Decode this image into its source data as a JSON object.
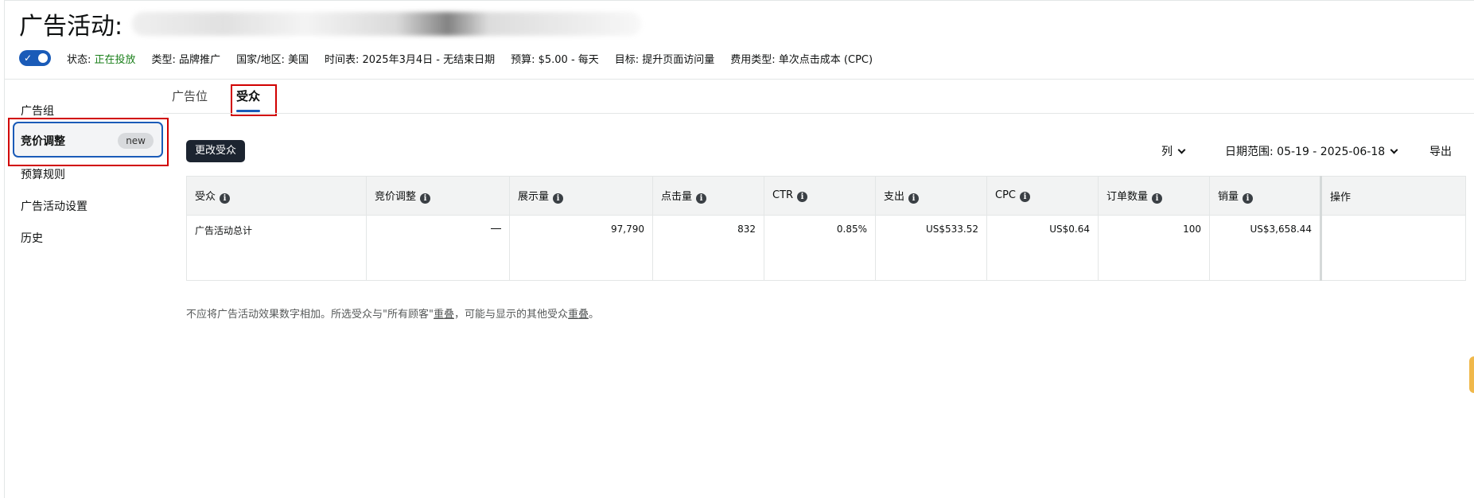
{
  "header": {
    "title": "广告活动:",
    "meta": {
      "status_label": "状态:",
      "status_value": "正在投放",
      "type": "类型: 品牌推广",
      "country": "国家/地区: 美国",
      "schedule": "时间表: 2025年3月4日 - 无结束日期",
      "budget": "预算: $5.00 - 每天",
      "goal": "目标: 提升页面访问量",
      "cost_type": "费用类型: 单次点击成本 (CPC)"
    }
  },
  "sidebar": {
    "items": [
      {
        "label": "广告组"
      },
      {
        "label": "竞价调整",
        "badge": "new"
      },
      {
        "label": "预算规则"
      },
      {
        "label": "广告活动设置"
      },
      {
        "label": "历史"
      }
    ]
  },
  "tabs": [
    {
      "label": "广告位"
    },
    {
      "label": "受众"
    }
  ],
  "toolbar": {
    "change_audience": "更改受众",
    "columns": "列",
    "date_range": "日期范围: 05-19 - 2025-06-18",
    "export": "导出"
  },
  "table": {
    "columns": [
      "受众",
      "竞价调整",
      "展示量",
      "点击量",
      "CTR",
      "支出",
      "CPC",
      "订单数量",
      "销量",
      "操作"
    ],
    "rows": [
      {
        "audience": "广告活动总计",
        "impressions": "97,790",
        "clicks": "832",
        "ctr": "0.85%",
        "spend": "US$533.52",
        "cpc": "US$0.64",
        "orders": "100",
        "sales": "US$3,658.44"
      }
    ]
  },
  "note": {
    "prefix": "不应将广告活动效果数字相加。所选受众与\"所有顾客\"",
    "link1": "重叠",
    "middle": "，可能与显示的其他受众",
    "link2": "重叠",
    "suffix": "。"
  },
  "colors": {
    "accent": "#1a5bb8",
    "status_green": "#1a7f1a",
    "annotation_red": "#d10000",
    "primary_button": "#1c2430"
  }
}
